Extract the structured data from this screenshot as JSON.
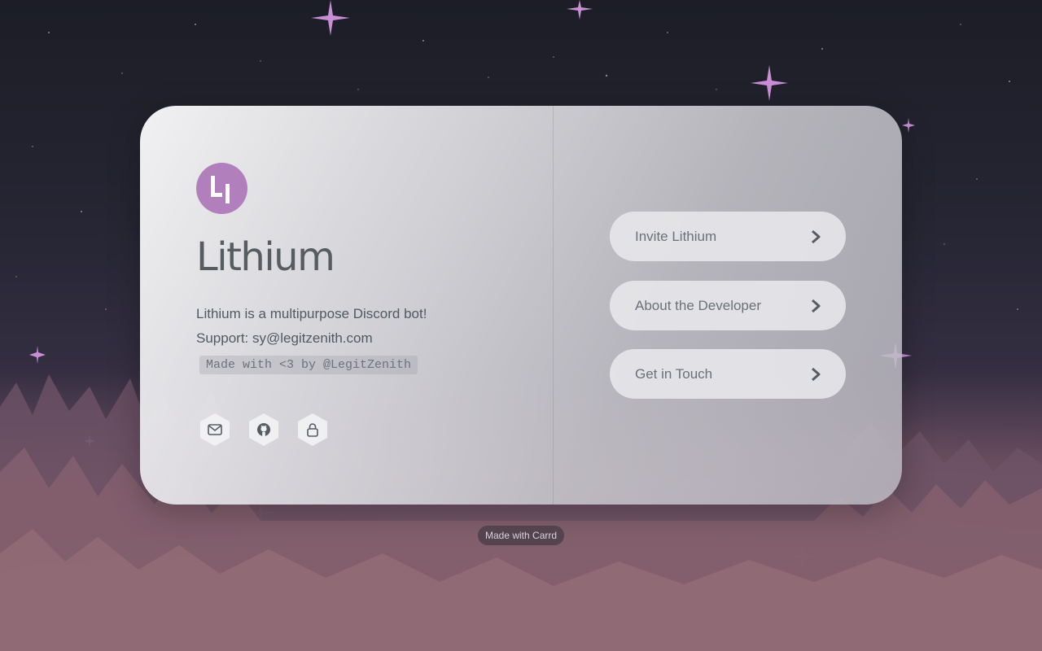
{
  "profile": {
    "logo_text": "LI",
    "title": "Lithium",
    "description": "Lithium is a multipurpose Discord bot!",
    "support": "Support: sy@legitzenith.com",
    "credit": "Made with <3 by @LegitZenith"
  },
  "socials": [
    {
      "icon": "mail-icon"
    },
    {
      "icon": "github-icon"
    },
    {
      "icon": "lock-icon"
    }
  ],
  "buttons": [
    {
      "label": "Invite Lithium"
    },
    {
      "label": "About the Developer"
    },
    {
      "label": "Get in Touch"
    }
  ],
  "footer": {
    "made_with": "Made with Carrd"
  },
  "colors": {
    "logo_bg": "#b27fbd",
    "text": "#555d63",
    "star": "#d9a7e8"
  }
}
